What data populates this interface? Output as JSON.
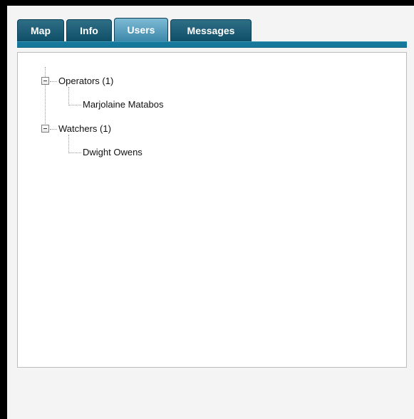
{
  "tabs": [
    {
      "label": "Map",
      "active": false
    },
    {
      "label": "Info",
      "active": false
    },
    {
      "label": "Users",
      "active": true
    },
    {
      "label": "Messages",
      "active": false
    }
  ],
  "tree": {
    "groups": [
      {
        "label": "Operators (1)",
        "expanded": true,
        "children": [
          "Marjolaine Matabos"
        ]
      },
      {
        "label": "Watchers (1)",
        "expanded": true,
        "children": [
          "Dwight Owens"
        ]
      }
    ]
  },
  "colors": {
    "tab_inactive": "#1f5f79",
    "tab_active": "#5ea7c7",
    "strip": "#16789a",
    "panel_border": "#bcbcbc"
  },
  "icons": {
    "collapse": "minus-square-icon"
  }
}
